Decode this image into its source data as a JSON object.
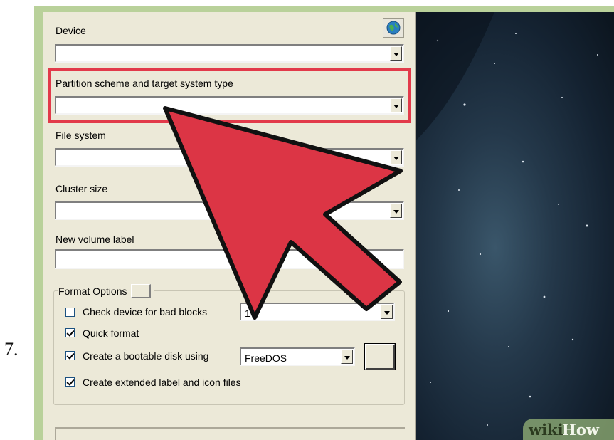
{
  "step": {
    "number": "7."
  },
  "dialog": {
    "device_label": "Device",
    "device_value": "",
    "partition_label": "Partition scheme and target system type",
    "partition_value": "",
    "filesystem_label": "File system",
    "filesystem_value": "",
    "cluster_label": "Cluster size",
    "cluster_value": "",
    "volume_label": "New volume label",
    "volume_value": "",
    "format_options": {
      "legend": "Format Options",
      "check_bad_blocks": {
        "label": "Check device for bad blocks",
        "checked": false,
        "passes_value": "1 P"
      },
      "quick_format": {
        "label": "Quick format",
        "checked": true
      },
      "bootable": {
        "label": "Create a bootable disk using",
        "checked": true,
        "selected": "FreeDOS"
      },
      "extended_label": {
        "label": "Create extended label and icon files",
        "checked": true
      }
    }
  },
  "icons": {
    "globe": "globe-icon",
    "pointer": "arrow-pointer-icon"
  },
  "colors": {
    "highlight": "#e23a4a",
    "arrow_fill": "#dc3545",
    "frame_green": "#b9d19a"
  },
  "watermark": {
    "part1": "wiki",
    "part2": "How"
  }
}
